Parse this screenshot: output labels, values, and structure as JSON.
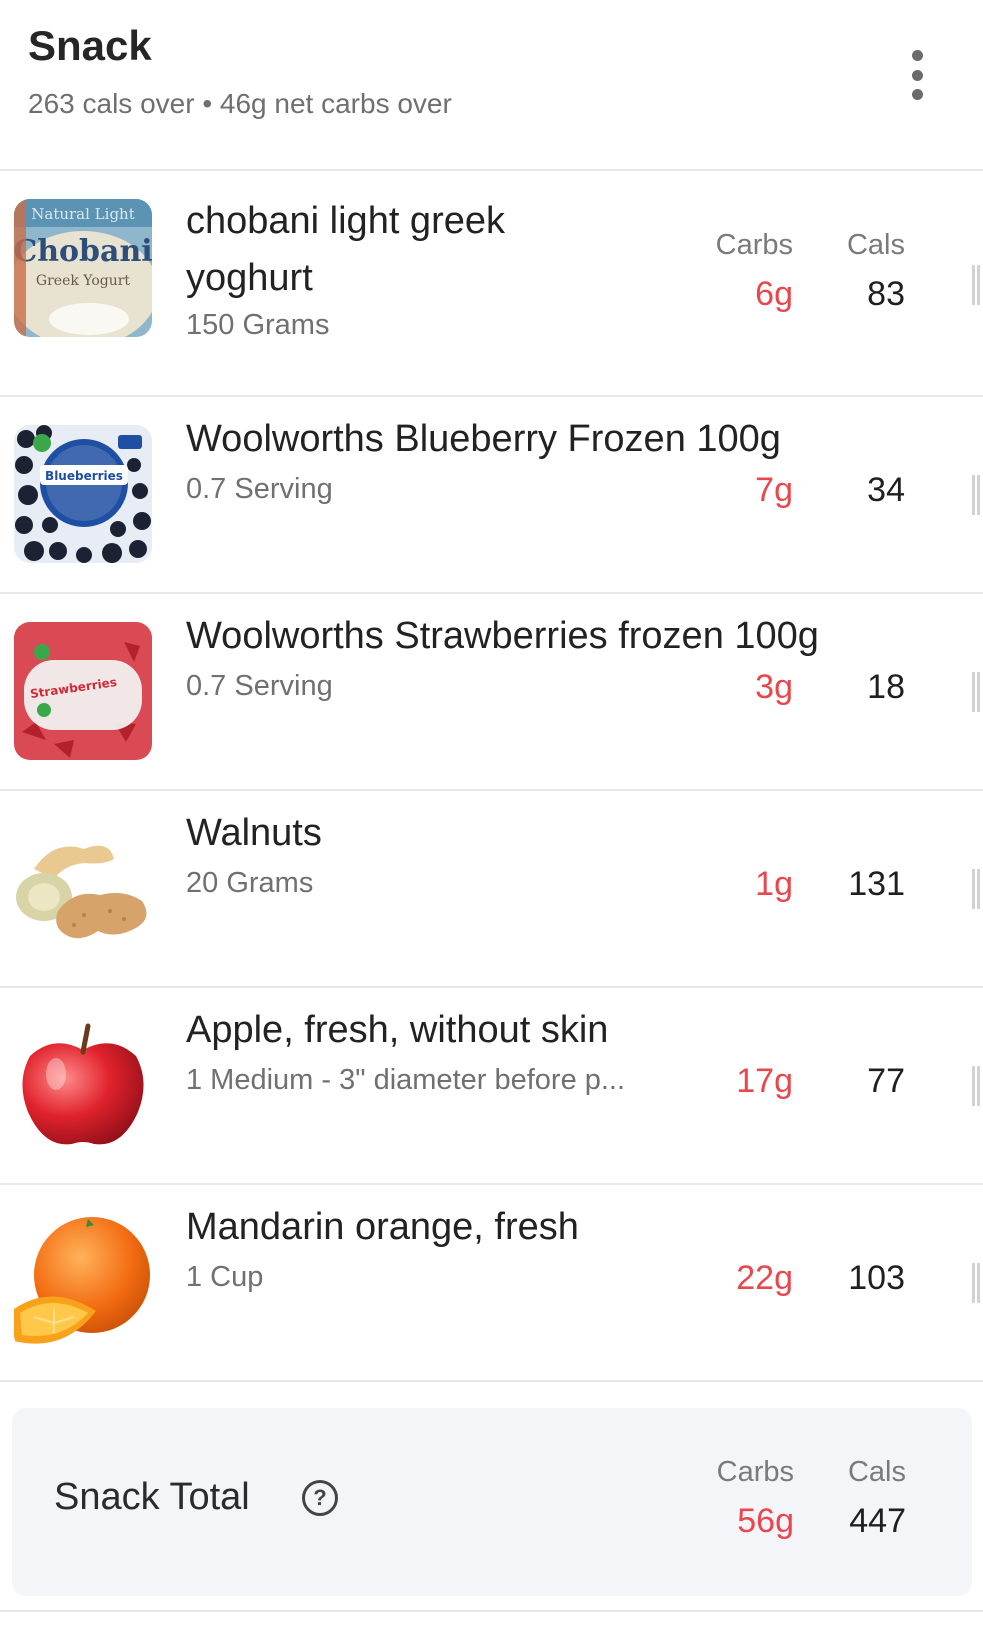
{
  "header": {
    "title": "Snack",
    "subtitle": "263 cals over • 46g net carbs over"
  },
  "columns": {
    "carbs_label": "Carbs",
    "cals_label": "Cals"
  },
  "items": [
    {
      "name_line1": "chobani light greek",
      "name_line2": "yoghurt",
      "quantity": "150 Grams",
      "carbs": "6g",
      "cals": "83",
      "image": "chobani-yogurt-image",
      "brand_text": "Chobani",
      "sub_text": "Greek Yogurt",
      "top_text": "Natural Light"
    },
    {
      "name": "Woolworths Blueberry Frozen 100g",
      "quantity": "0.7 Serving",
      "carbs": "7g",
      "cals": "34",
      "image": "blueberries-pack-image",
      "pack_label": "Blueberries"
    },
    {
      "name": "Woolworths Strawberries frozen 100g",
      "quantity": "0.7 Serving",
      "carbs": "3g",
      "cals": "18",
      "image": "strawberries-pack-image",
      "pack_label": "Strawberries"
    },
    {
      "name": "Walnuts",
      "quantity": "20 Grams",
      "carbs": "1g",
      "cals": "131",
      "image": "nuts-icon"
    },
    {
      "name": "Apple, fresh, without skin",
      "quantity": "1 Medium - 3\" diameter before p...",
      "carbs": "17g",
      "cals": "77",
      "image": "apple-icon"
    },
    {
      "name": "Mandarin orange, fresh",
      "quantity": "1 Cup",
      "carbs": "22g",
      "cals": "103",
      "image": "orange-icon"
    }
  ],
  "total": {
    "label": "Snack Total",
    "carbs": "56g",
    "cals": "447",
    "help_icon": "question-circle-icon",
    "help_glyph": "?"
  },
  "colors": {
    "carbs": "#e8474d",
    "divider": "#e8e8e8",
    "total_bg": "#f4f5f9"
  }
}
